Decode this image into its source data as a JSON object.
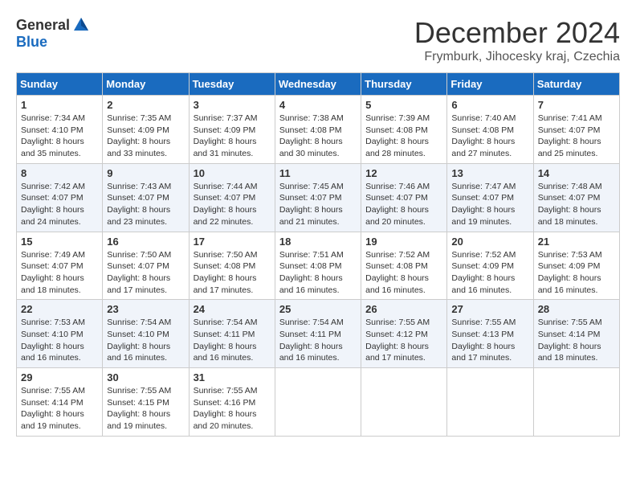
{
  "header": {
    "logo_general": "General",
    "logo_blue": "Blue",
    "title": "December 2024",
    "location": "Frymburk, Jihocesky kraj, Czechia"
  },
  "days_of_week": [
    "Sunday",
    "Monday",
    "Tuesday",
    "Wednesday",
    "Thursday",
    "Friday",
    "Saturday"
  ],
  "weeks": [
    [
      {
        "day": "1",
        "sunrise": "7:34 AM",
        "sunset": "4:10 PM",
        "daylight": "8 hours and 35 minutes."
      },
      {
        "day": "2",
        "sunrise": "7:35 AM",
        "sunset": "4:09 PM",
        "daylight": "8 hours and 33 minutes."
      },
      {
        "day": "3",
        "sunrise": "7:37 AM",
        "sunset": "4:09 PM",
        "daylight": "8 hours and 31 minutes."
      },
      {
        "day": "4",
        "sunrise": "7:38 AM",
        "sunset": "4:08 PM",
        "daylight": "8 hours and 30 minutes."
      },
      {
        "day": "5",
        "sunrise": "7:39 AM",
        "sunset": "4:08 PM",
        "daylight": "8 hours and 28 minutes."
      },
      {
        "day": "6",
        "sunrise": "7:40 AM",
        "sunset": "4:08 PM",
        "daylight": "8 hours and 27 minutes."
      },
      {
        "day": "7",
        "sunrise": "7:41 AM",
        "sunset": "4:07 PM",
        "daylight": "8 hours and 25 minutes."
      }
    ],
    [
      {
        "day": "8",
        "sunrise": "7:42 AM",
        "sunset": "4:07 PM",
        "daylight": "8 hours and 24 minutes."
      },
      {
        "day": "9",
        "sunrise": "7:43 AM",
        "sunset": "4:07 PM",
        "daylight": "8 hours and 23 minutes."
      },
      {
        "day": "10",
        "sunrise": "7:44 AM",
        "sunset": "4:07 PM",
        "daylight": "8 hours and 22 minutes."
      },
      {
        "day": "11",
        "sunrise": "7:45 AM",
        "sunset": "4:07 PM",
        "daylight": "8 hours and 21 minutes."
      },
      {
        "day": "12",
        "sunrise": "7:46 AM",
        "sunset": "4:07 PM",
        "daylight": "8 hours and 20 minutes."
      },
      {
        "day": "13",
        "sunrise": "7:47 AM",
        "sunset": "4:07 PM",
        "daylight": "8 hours and 19 minutes."
      },
      {
        "day": "14",
        "sunrise": "7:48 AM",
        "sunset": "4:07 PM",
        "daylight": "8 hours and 18 minutes."
      }
    ],
    [
      {
        "day": "15",
        "sunrise": "7:49 AM",
        "sunset": "4:07 PM",
        "daylight": "8 hours and 18 minutes."
      },
      {
        "day": "16",
        "sunrise": "7:50 AM",
        "sunset": "4:07 PM",
        "daylight": "8 hours and 17 minutes."
      },
      {
        "day": "17",
        "sunrise": "7:50 AM",
        "sunset": "4:08 PM",
        "daylight": "8 hours and 17 minutes."
      },
      {
        "day": "18",
        "sunrise": "7:51 AM",
        "sunset": "4:08 PM",
        "daylight": "8 hours and 16 minutes."
      },
      {
        "day": "19",
        "sunrise": "7:52 AM",
        "sunset": "4:08 PM",
        "daylight": "8 hours and 16 minutes."
      },
      {
        "day": "20",
        "sunrise": "7:52 AM",
        "sunset": "4:09 PM",
        "daylight": "8 hours and 16 minutes."
      },
      {
        "day": "21",
        "sunrise": "7:53 AM",
        "sunset": "4:09 PM",
        "daylight": "8 hours and 16 minutes."
      }
    ],
    [
      {
        "day": "22",
        "sunrise": "7:53 AM",
        "sunset": "4:10 PM",
        "daylight": "8 hours and 16 minutes."
      },
      {
        "day": "23",
        "sunrise": "7:54 AM",
        "sunset": "4:10 PM",
        "daylight": "8 hours and 16 minutes."
      },
      {
        "day": "24",
        "sunrise": "7:54 AM",
        "sunset": "4:11 PM",
        "daylight": "8 hours and 16 minutes."
      },
      {
        "day": "25",
        "sunrise": "7:54 AM",
        "sunset": "4:11 PM",
        "daylight": "8 hours and 16 minutes."
      },
      {
        "day": "26",
        "sunrise": "7:55 AM",
        "sunset": "4:12 PM",
        "daylight": "8 hours and 17 minutes."
      },
      {
        "day": "27",
        "sunrise": "7:55 AM",
        "sunset": "4:13 PM",
        "daylight": "8 hours and 17 minutes."
      },
      {
        "day": "28",
        "sunrise": "7:55 AM",
        "sunset": "4:14 PM",
        "daylight": "8 hours and 18 minutes."
      }
    ],
    [
      {
        "day": "29",
        "sunrise": "7:55 AM",
        "sunset": "4:14 PM",
        "daylight": "8 hours and 19 minutes."
      },
      {
        "day": "30",
        "sunrise": "7:55 AM",
        "sunset": "4:15 PM",
        "daylight": "8 hours and 19 minutes."
      },
      {
        "day": "31",
        "sunrise": "7:55 AM",
        "sunset": "4:16 PM",
        "daylight": "8 hours and 20 minutes."
      },
      null,
      null,
      null,
      null
    ]
  ],
  "labels": {
    "sunrise": "Sunrise:",
    "sunset": "Sunset:",
    "daylight": "Daylight:"
  }
}
